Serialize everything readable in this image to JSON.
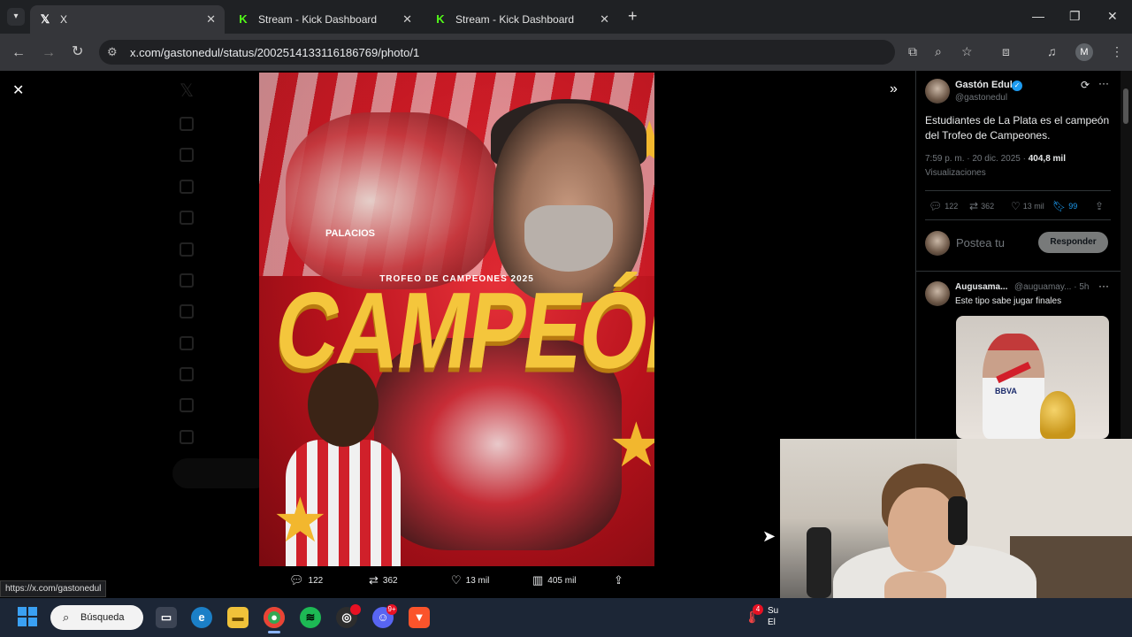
{
  "browser": {
    "tabs": [
      {
        "label": "X",
        "favicon": "x-logo-icon",
        "active": true
      },
      {
        "label": "Stream - Kick Dashboard",
        "favicon": "kick-logo-icon",
        "active": false
      },
      {
        "label": "Stream - Kick Dashboard",
        "favicon": "kick-logo-icon",
        "active": false
      }
    ],
    "url": "x.com/gastonedul/status/2002514133116186769/photo/1",
    "profile_initial": "M",
    "accent_color": "#35363a"
  },
  "poster": {
    "trofeo": "TROFEO DE CAMPEONES 2025",
    "headline": "CAMPEÓN",
    "jersey_name": "PALACIOS"
  },
  "photo_actions": {
    "replies": "122",
    "reposts": "362",
    "likes": "13 mil",
    "views": "405 mil"
  },
  "tweet": {
    "author_name": "Gastón Edul",
    "author_handle": "@gastonedul",
    "text": "Estudiantes de La Plata es el campeón del Trofeo de Campeones.",
    "time": "7:59 p. m. · 20 dic. 2025 · ",
    "views_count": "404,8 mil",
    "views_label": "Visualizaciones",
    "stats": {
      "replies": "122",
      "reposts": "362",
      "likes": "13 mil",
      "bookmarks": "99"
    },
    "reply_placeholder": "Postea tu",
    "reply_button": "Responder"
  },
  "reply": {
    "name": "Augusama...",
    "handle": "@auguamay... · 5h",
    "text": "Este tipo sabe jugar finales",
    "image_text": "BBVA"
  },
  "status_url": "https://x.com/gastonedul",
  "taskbar": {
    "search_label": "Búsqueda",
    "weather_line1": "Su",
    "weather_line2": "El",
    "weather_badge": "4",
    "discord_badge": "9+"
  },
  "colors": {
    "x_blue": "#1d9bf0",
    "poster_red": "#d21f2a",
    "poster_gold": "#f4c63c",
    "taskbar": "#1c2636"
  }
}
